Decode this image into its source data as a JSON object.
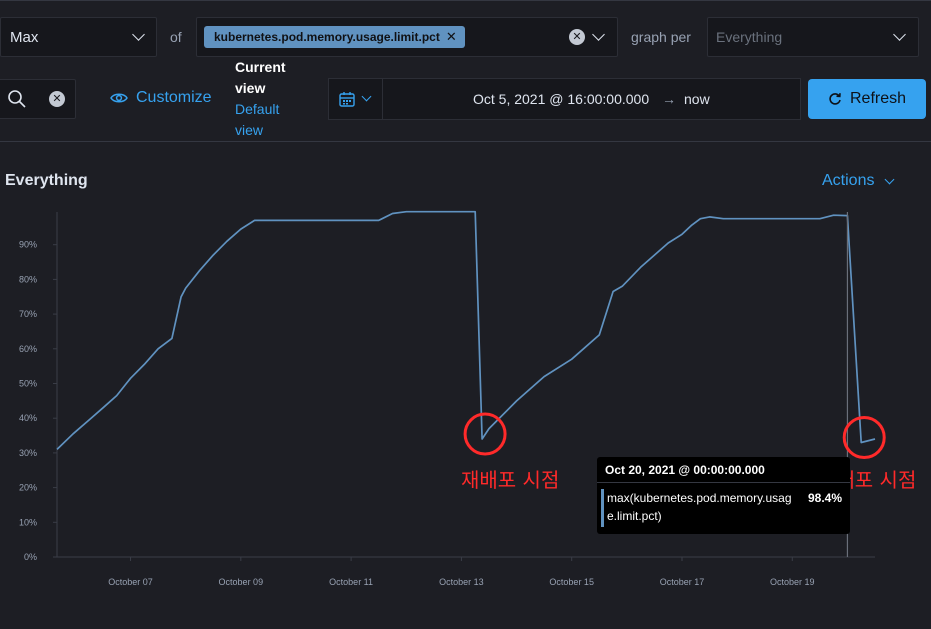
{
  "toolbar": {
    "aggregation": "Max",
    "of_label": "of",
    "metric_pill": "kubernetes.pod.memory.usage.limit.pct",
    "graph_per_label": "graph per",
    "group_placeholder": "Everything"
  },
  "controls": {
    "customize_label": "Customize",
    "current_view_label": "Current view",
    "default_view_label": "Default view",
    "date_start": "Oct 5, 2021 @ 16:00:00.000",
    "date_arrow": "→",
    "date_end": "now",
    "refresh_label": "Refresh"
  },
  "panel": {
    "title": "Everything",
    "actions_label": "Actions"
  },
  "tooltip": {
    "time": "Oct 20, 2021 @ 00:00:00.000",
    "series": "max(kubernetes.pod.memory.usage.limit.pct)",
    "value": "98.4%"
  },
  "annotations": [
    "재배포 시점",
    "재배포 시점"
  ],
  "colors": {
    "accent": "#36a2ef",
    "series": "#6092c0",
    "annotation": "#ff2a2a",
    "background": "#1d1e24"
  },
  "chart_data": {
    "type": "line",
    "title": "Everything",
    "y_ticks": [
      "0%",
      "10%",
      "20%",
      "30%",
      "40%",
      "50%",
      "60%",
      "70%",
      "80%",
      "90%"
    ],
    "x_ticks": [
      "October 07",
      "October 09",
      "October 11",
      "October 13",
      "October 15",
      "October 17",
      "October 19"
    ],
    "ylim": [
      0,
      1
    ],
    "xlim": [
      "2021-10-05T16:00:00",
      "2021-10-20T12:00:00"
    ],
    "grid": false,
    "series": [
      {
        "x": [
          "2021-10-05T16:00",
          "2021-10-05T23:00",
          "2021-10-06T06:00",
          "2021-10-06T12:00",
          "2021-10-06T18:00",
          "2021-10-07T00:00",
          "2021-10-07T06:00",
          "2021-10-07T12:00",
          "2021-10-07T18:00",
          "2021-10-07T22:00",
          "2021-10-08T00:00",
          "2021-10-08T06:00",
          "2021-10-08T12:00",
          "2021-10-08T18:00",
          "2021-10-09T00:00",
          "2021-10-09T06:00",
          "2021-10-09T12:00",
          "2021-10-09T18:00",
          "2021-10-10T00:00",
          "2021-10-10T12:00",
          "2021-10-11T00:00",
          "2021-10-11T12:00",
          "2021-10-11T18:00",
          "2021-10-12T00:00",
          "2021-10-12T12:00",
          "2021-10-13T00:00",
          "2021-10-13T06:00",
          "2021-10-13T09:00",
          "2021-10-13T12:00",
          "2021-10-14T00:00",
          "2021-10-14T12:00",
          "2021-10-15T00:00",
          "2021-10-15T12:00",
          "2021-10-15T18:00",
          "2021-10-15T22:00",
          "2021-10-16T06:00",
          "2021-10-16T12:00",
          "2021-10-16T18:00",
          "2021-10-17T00:00",
          "2021-10-17T04:00",
          "2021-10-17T08:00",
          "2021-10-17T12:00",
          "2021-10-17T18:00",
          "2021-10-18T00:00",
          "2021-10-18T12:00",
          "2021-10-19T00:00",
          "2021-10-19T12:00",
          "2021-10-19T18:00",
          "2021-10-20T00:00",
          "2021-10-20T06:00",
          "2021-10-20T12:00"
        ],
        "y": [
          0.31,
          0.355,
          0.395,
          0.43,
          0.465,
          0.515,
          0.555,
          0.6,
          0.63,
          0.75,
          0.775,
          0.825,
          0.87,
          0.91,
          0.945,
          0.97,
          0.97,
          0.97,
          0.97,
          0.97,
          0.97,
          0.97,
          0.99,
          0.995,
          0.995,
          0.995,
          0.995,
          0.34,
          0.37,
          0.45,
          0.52,
          0.57,
          0.64,
          0.765,
          0.78,
          0.835,
          0.87,
          0.905,
          0.93,
          0.955,
          0.975,
          0.98,
          0.975,
          0.975,
          0.975,
          0.975,
          0.975,
          0.985,
          0.984,
          0.33,
          0.34
        ]
      }
    ]
  }
}
